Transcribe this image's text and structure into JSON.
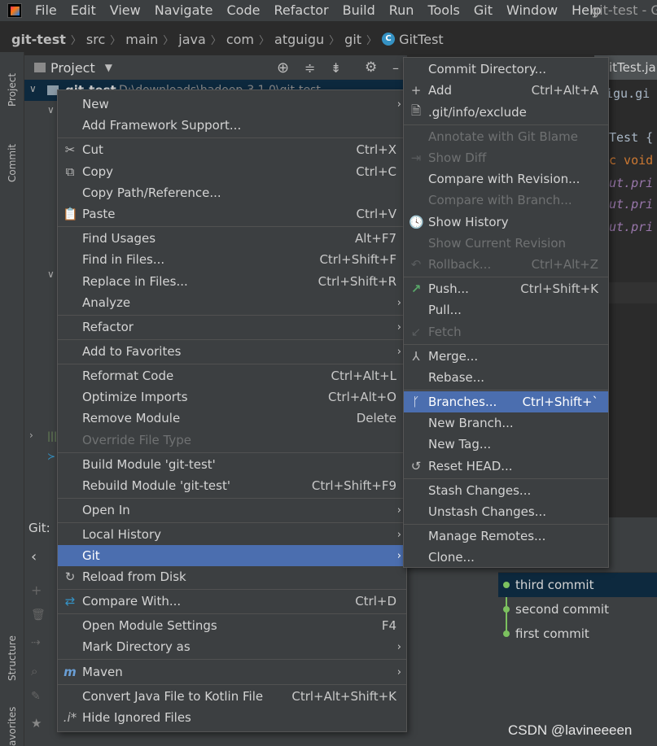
{
  "menubar": {
    "items": [
      "File",
      "Edit",
      "View",
      "Navigate",
      "Code",
      "Refactor",
      "Build",
      "Run",
      "Tools",
      "Git",
      "Window",
      "Help"
    ],
    "window_title": "git-test - Gi"
  },
  "breadcrumb": [
    "git-test",
    "src",
    "main",
    "java",
    "com",
    "atguigu",
    "git",
    "GitTest"
  ],
  "left_strip": {
    "project": "Project",
    "commit": "Commit",
    "structure": "Structure",
    "favorites": "avorites"
  },
  "project_panel": {
    "title": "Project",
    "root_label": "git-test",
    "root_path": "D:\\downloads\\hadoop-3.1.0\\git-test"
  },
  "git_panel": {
    "label": "Git:"
  },
  "editor": {
    "tab": "itTest.ja",
    "lines": [
      "igu.gi",
      "Test {",
      "c void",
      "ut.pri",
      "ut.pri",
      "ut.pri"
    ]
  },
  "context_menu": {
    "items": [
      {
        "label": "New",
        "submenu": true
      },
      {
        "label": "Add Framework Support..."
      },
      {
        "label": "Cut",
        "shortcut": "Ctrl+X",
        "icon": "scissors-icon"
      },
      {
        "label": "Copy",
        "shortcut": "Ctrl+C",
        "icon": "copy-icon"
      },
      {
        "label": "Copy Path/Reference..."
      },
      {
        "label": "Paste",
        "shortcut": "Ctrl+V",
        "icon": "paste-icon"
      },
      {
        "label": "Find Usages",
        "shortcut": "Alt+F7"
      },
      {
        "label": "Find in Files...",
        "shortcut": "Ctrl+Shift+F"
      },
      {
        "label": "Replace in Files...",
        "shortcut": "Ctrl+Shift+R"
      },
      {
        "label": "Analyze",
        "submenu": true
      },
      {
        "label": "Refactor",
        "submenu": true
      },
      {
        "label": "Add to Favorites",
        "submenu": true
      },
      {
        "label": "Reformat Code",
        "shortcut": "Ctrl+Alt+L"
      },
      {
        "label": "Optimize Imports",
        "shortcut": "Ctrl+Alt+O"
      },
      {
        "label": "Remove Module",
        "shortcut": "Delete"
      },
      {
        "label": "Override File Type",
        "disabled": true
      },
      {
        "label": "Build Module 'git-test'"
      },
      {
        "label": "Rebuild Module 'git-test'",
        "shortcut": "Ctrl+Shift+F9"
      },
      {
        "label": "Open In",
        "submenu": true
      },
      {
        "label": "Local History",
        "submenu": true
      },
      {
        "label": "Git",
        "submenu": true,
        "selected": true
      },
      {
        "label": "Reload from Disk",
        "icon": "reload-icon"
      },
      {
        "label": "Compare With...",
        "shortcut": "Ctrl+D",
        "icon": "compare-icon"
      },
      {
        "label": "Open Module Settings",
        "shortcut": "F4"
      },
      {
        "label": "Mark Directory as",
        "submenu": true
      },
      {
        "label": "Maven",
        "submenu": true,
        "icon": "maven-icon"
      },
      {
        "label": "Convert Java File to Kotlin File",
        "shortcut": "Ctrl+Alt+Shift+K"
      },
      {
        "label": "Hide Ignored Files",
        "icon": "ignored-files-icon"
      }
    ]
  },
  "git_submenu": {
    "items": [
      {
        "label": "Commit Directory..."
      },
      {
        "label": "Add",
        "shortcut": "Ctrl+Alt+A",
        "icon": "plus-icon"
      },
      {
        "label": ".git/info/exclude",
        "icon": "exclude-file-icon"
      },
      {
        "label": "Annotate with Git Blame",
        "disabled": true
      },
      {
        "label": "Show Diff",
        "disabled": true,
        "icon": "diff-icon"
      },
      {
        "label": "Compare with Revision..."
      },
      {
        "label": "Compare with Branch...",
        "disabled": true
      },
      {
        "label": "Show History",
        "icon": "history-icon"
      },
      {
        "label": "Show Current Revision",
        "disabled": true
      },
      {
        "label": "Rollback...",
        "shortcut": "Ctrl+Alt+Z",
        "disabled": true,
        "icon": "rollback-icon"
      },
      {
        "label": "Push...",
        "shortcut": "Ctrl+Shift+K",
        "icon": "push-arrow-icon"
      },
      {
        "label": "Pull..."
      },
      {
        "label": "Fetch",
        "disabled": true,
        "icon": "fetch-icon"
      },
      {
        "label": "Merge...",
        "icon": "merge-icon"
      },
      {
        "label": "Rebase..."
      },
      {
        "label": "Branches...",
        "shortcut": "Ctrl+Shift+`",
        "selected": true,
        "icon": "branch-icon"
      },
      {
        "label": "New Branch..."
      },
      {
        "label": "New Tag..."
      },
      {
        "label": "Reset HEAD...",
        "icon": "reset-icon"
      },
      {
        "label": "Stash Changes..."
      },
      {
        "label": "Unstash Changes..."
      },
      {
        "label": "Manage Remotes..."
      },
      {
        "label": "Clone..."
      }
    ]
  },
  "commits": [
    "third commit",
    "second commit",
    "first commit"
  ],
  "watermark": "CSDN @lavineeeen",
  "colors": {
    "selection": "#4b6eaf",
    "menu_bg": "#3c3f41",
    "editor_bg": "#2b2b2b",
    "commit_dot": "#7cc15f",
    "push_arrow": "#59a869"
  }
}
